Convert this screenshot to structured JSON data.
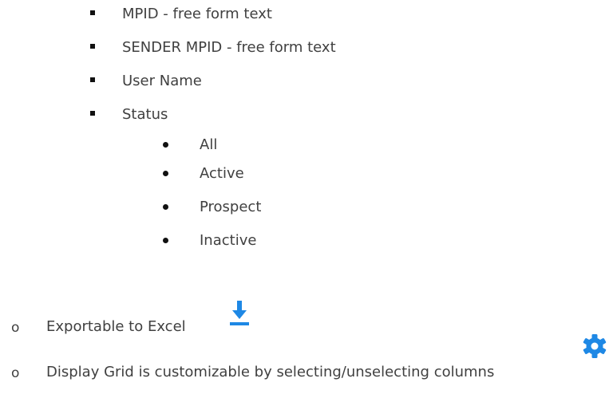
{
  "square_items": [
    "MPID - free form text",
    "SENDER MPID - free form text",
    "User Name",
    "Status"
  ],
  "status_options": [
    "All",
    "Active",
    "Prospect",
    "Inactive"
  ],
  "outer_items": [
    {
      "text": "Exportable to Excel",
      "icon": "download-icon",
      "icon_color": "#1e88e5"
    },
    {
      "text": "Display Grid is customizable by selecting/unselecting columns",
      "icon": "gear-icon",
      "icon_color": "#1e88e5"
    }
  ],
  "bullet_marker": "o"
}
